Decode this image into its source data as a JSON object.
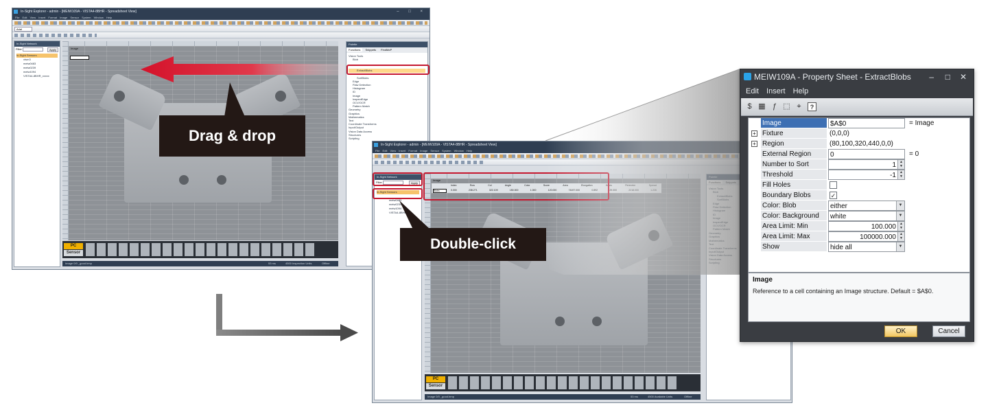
{
  "window1": {
    "title": "In-Sight Explorer - admin - [MEIW109A - VISTA4-8BHR - Spreadsheet View]",
    "menu": "File Edit View Insert Format Image Sensor System Window Help",
    "font": "Arial",
    "palette_title": "In-Sight Network",
    "filter_label": "Filter",
    "apply_label": "Apply",
    "tree": [
      "In-Sight Sensors",
      "vtsm3",
      "meiw0483",
      "meiw0239",
      "meiw1094",
      "VISTA4-8BHR_xxxxx"
    ],
    "palette2_title": "Palette",
    "tabs": [
      "Functions",
      "Snippets",
      "FindMoP"
    ],
    "functions": [
      "Vision Tools",
      "Blob",
      "ExtractBlobs",
      "SortBlobs",
      "Edge",
      "Flaw Detection",
      "Histogram",
      "ID",
      "Image",
      "InspectEdge",
      "OCV/OCR",
      "Pattern Match",
      "Geometry",
      "Graphics",
      "Mathematics",
      "Text",
      "Coordinate Transforms",
      "Input/Output",
      "Vision Data Access",
      "Structures",
      "Scripting"
    ],
    "cell_label": "Image",
    "statusbar": "Image 0/0 _good.bmp",
    "status_right": [
      "53 ms",
      "4500 Inspection Units",
      "Offline"
    ]
  },
  "window2": {
    "title": "In-Sight Explorer - admin - [MEIW109A - VISTA4-8BHR - Spreadsheet View]",
    "menu": "File Edit View Insert Format Image Sensor System Window Help",
    "palette_title": "In-Sight Network",
    "filter_label": "Filter",
    "apply_label": "Apply",
    "tree_selected": "In-Sight Sensors",
    "tree": [
      "meiw0483",
      "meiw0239",
      "meiw1094",
      "VISTA4-8BHR"
    ],
    "blob_headers": [
      "Index",
      "Row",
      "Col",
      "Angle",
      "Color",
      "Score",
      "Area",
      "Elongation",
      "Holes",
      "Perimeter",
      "Spread"
    ],
    "blob_values": [
      "0.000",
      "238.271",
      "322.109",
      "150.000",
      "1.000",
      "120.000",
      "74497.000",
      "0.892",
      "29.000",
      "2218.000",
      "1.226"
    ],
    "cell_a0": "Image",
    "cell_a1": "Blobs",
    "statusbar": "Image 0/0 _good.bmp",
    "status_right": [
      "53 ms",
      "4500 Available Units",
      "Offline"
    ],
    "palette2_title": "Palette",
    "tabs": [
      "Functions",
      "Snippets",
      "FindMoP"
    ],
    "functions": [
      "Vision Tools",
      "Blob",
      "ExtractBlobs",
      "SortBlobs",
      "Edge",
      "Flaw Detection",
      "Histogram",
      "ID",
      "Image",
      "InspectEdge",
      "OCV/OCR",
      "Pattern Match",
      "Geometry",
      "Graphics",
      "Mathematics",
      "Text",
      "Coordinate Transforms",
      "Input/Output",
      "Vision Data Access",
      "Structures",
      "Scripting"
    ]
  },
  "film": {
    "pc": "PC",
    "sensor": "Sensor"
  },
  "callouts": {
    "drag": "Drag & drop",
    "dbl": "Double-click"
  },
  "colors": {
    "highlight_red": "#c5172e",
    "callout_bg": "#231815",
    "arrow_red": "#d4122a"
  },
  "property_sheet": {
    "title": "MEIW109A - Property Sheet - ExtractBlobs",
    "menu": [
      "Edit",
      "Insert",
      "Help"
    ],
    "rows": [
      {
        "label": "Image",
        "value": "$A$0",
        "suffix": "= Image",
        "kind": "text"
      },
      {
        "label": "Fixture",
        "value": "(0,0,0)",
        "kind": "expand"
      },
      {
        "label": "Region",
        "value": "(80,100,320,440,0,0)",
        "kind": "expand"
      },
      {
        "label": "External Region",
        "value": "0",
        "suffix": "= 0",
        "kind": "text"
      },
      {
        "label": "Number to Sort",
        "value": "1",
        "kind": "spin"
      },
      {
        "label": "Threshold",
        "value": "-1",
        "kind": "spin"
      },
      {
        "label": "Fill Holes",
        "value": "",
        "kind": "check"
      },
      {
        "label": "Boundary Blobs",
        "value": "✓",
        "kind": "check"
      },
      {
        "label": "Color: Blob",
        "value": "either",
        "kind": "combo"
      },
      {
        "label": "Color: Background",
        "value": "white",
        "kind": "combo"
      },
      {
        "label": "Area Limit: Min",
        "value": "100.000",
        "kind": "spin"
      },
      {
        "label": "Area Limit: Max",
        "value": "100000.000",
        "kind": "spin"
      },
      {
        "label": "Show",
        "value": "hide all",
        "kind": "combo"
      }
    ],
    "help_title": "Image",
    "help_text": "Reference to a cell containing an Image structure. Default = $A$0.",
    "ok": "OK",
    "cancel": "Cancel"
  }
}
